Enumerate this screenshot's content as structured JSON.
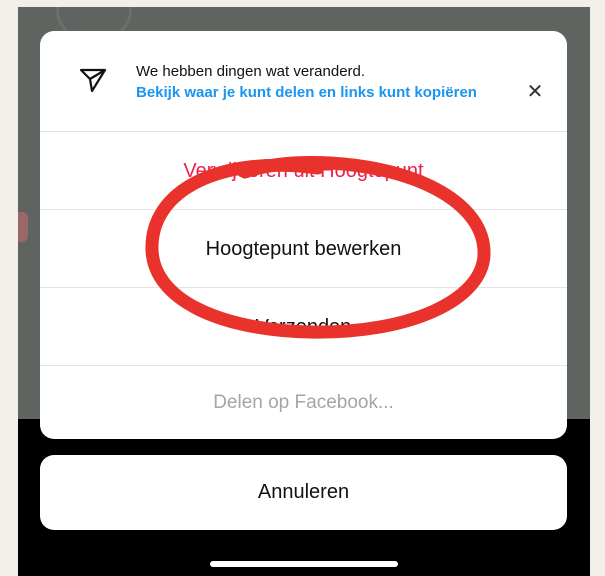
{
  "notice": {
    "title": "We hebben dingen wat veranderd.",
    "link": "Bekijk waar je kunt delen en links kunt kopiëren",
    "icon": "send-icon",
    "close_icon": "close-icon"
  },
  "actions": [
    {
      "label": "Verwijderen uit Hoogtepunt",
      "color": "#ee1f4f"
    },
    {
      "label": "Hoogtepunt bewerken",
      "color": "#111111"
    },
    {
      "label": "Verzenden",
      "color": "#111111"
    },
    {
      "label": "Delen op Facebook...",
      "color": "#a5a5a5"
    }
  ],
  "cancel_label": "Annuleren",
  "annotation": {
    "color": "#e8322b"
  }
}
